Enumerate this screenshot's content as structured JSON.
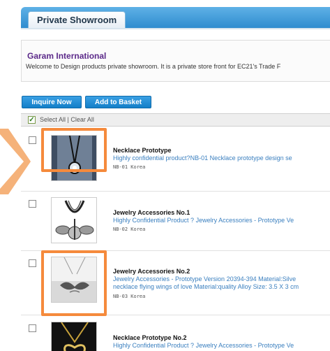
{
  "tab": {
    "title": "Private Showroom"
  },
  "info": {
    "company": "Garam International",
    "welcome": "Welcome to Design products private showroom. It is a private store front for EC21's Trade F"
  },
  "toolbar": {
    "inquire_label": "Inquire Now",
    "basket_label": "Add to Basket"
  },
  "selection": {
    "text": "Select All | Clear All"
  },
  "products": [
    {
      "name": "Necklace Prototype",
      "desc1": "Highly confidential product?NB-01 Necklace prototype design se",
      "desc2": "",
      "code": "NB-01 Korea"
    },
    {
      "name": "Jewelry Accessories No.1",
      "desc1": "Highly Confidential Product ? Jewelry Accessories - Prototype Ve",
      "desc2": "",
      "code": "NB-02 Korea"
    },
    {
      "name": "Jewelry Accessories No.2",
      "desc1": "Jewelry Accessories - Prototype Version 20394-394 Material:Silve",
      "desc2": "necklace flying wings of love Material:quality Alloy Size: 3.5 X 3 cm",
      "code": "NB-03 Korea"
    },
    {
      "name": "Necklace Prototype No.2",
      "desc1": "Highly Confidential Product ? Jewelry Accessories - Prototype Ve",
      "desc2": "",
      "code": ""
    }
  ],
  "colors": {
    "accent": "#1a86d0",
    "highlight": "#f58a3c",
    "company": "#5c2a8a",
    "link": "#3a7fbf"
  }
}
